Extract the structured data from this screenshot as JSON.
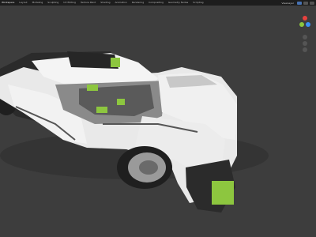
{
  "menu": {
    "items": [
      "Workspace",
      "Layout",
      "Modeling",
      "Sculpting",
      "UV Editing",
      "Texture Paint",
      "Shading",
      "Animation",
      "Rendering",
      "Compositing",
      "Geometry Nodes",
      "Scripting"
    ],
    "active_index": 0
  },
  "header_right": {
    "view_layer": "ViewLayer"
  },
  "viewport": {
    "background": "#3d3d3d",
    "model_colors": {
      "body": "#ececec",
      "dark": "#2b2b2b",
      "accent": "#8dc63f",
      "tire": "#1f1f1f",
      "rim": "#9a9a9a"
    }
  },
  "gizmo": {
    "x_color": "#e8413e",
    "y_color": "#8cc63e",
    "z_color": "#3b8ff7"
  }
}
